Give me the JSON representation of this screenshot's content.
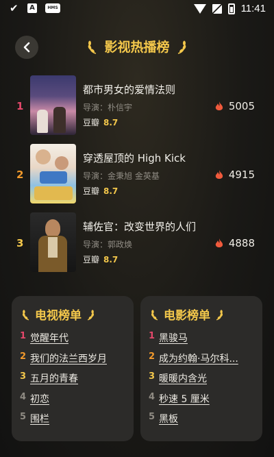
{
  "status_bar": {
    "time": "11:41",
    "badges": [
      "A",
      "HMS"
    ]
  },
  "header": {
    "title": "影视热播榜"
  },
  "colors": {
    "gold": "#f3c74b",
    "rank1": "#e5486b",
    "rank2": "#f39a2c",
    "rank3": "#f3c74b",
    "rank_other": "#8f8b83",
    "flame": "#f05a3c"
  },
  "rankings": [
    {
      "rank": "1",
      "title": "都市男女的爱情法则",
      "director": "导演：朴信宇",
      "score_label": "豆瓣",
      "score": "8.7",
      "heat": "5005"
    },
    {
      "rank": "2",
      "title": "穿透屋顶的 High Kick",
      "director": "导演：金秉旭 金英基",
      "score_label": "豆瓣",
      "score": "8.7",
      "heat": "4915"
    },
    {
      "rank": "3",
      "title": "辅佐官：改变世界的人们",
      "director": "导演：郭政焕",
      "score_label": "豆瓣",
      "score": "8.7",
      "heat": "4888"
    }
  ],
  "tv_list": {
    "title": "电视榜单",
    "items": [
      {
        "n": "1",
        "title": "觉醒年代"
      },
      {
        "n": "2",
        "title": "我们的法兰西岁月"
      },
      {
        "n": "3",
        "title": "五月的青春"
      },
      {
        "n": "4",
        "title": "初恋"
      },
      {
        "n": "5",
        "title": "围栏"
      }
    ]
  },
  "movie_list": {
    "title": "电影榜单",
    "items": [
      {
        "n": "1",
        "title": "黑骏马"
      },
      {
        "n": "2",
        "title": "成为约翰·马尔科..."
      },
      {
        "n": "3",
        "title": "暖暖内含光"
      },
      {
        "n": "4",
        "title": "秒速 5 厘米"
      },
      {
        "n": "5",
        "title": "黑板"
      }
    ]
  }
}
